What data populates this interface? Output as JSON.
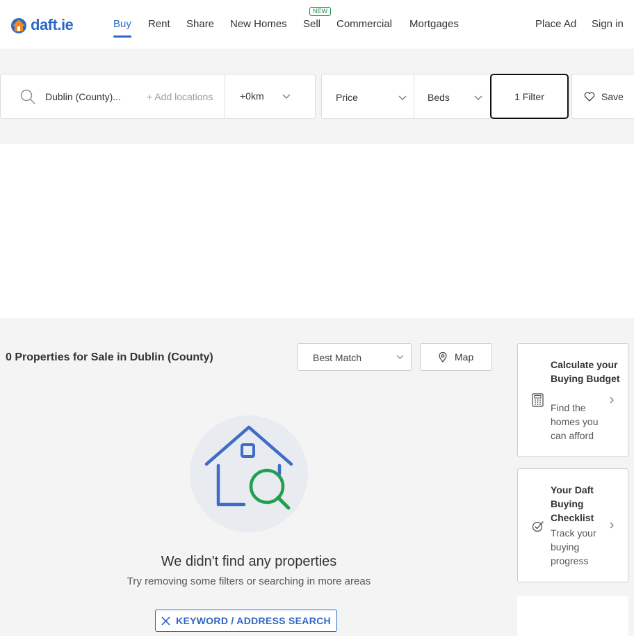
{
  "header": {
    "logo_text": "daft.ie",
    "nav": [
      {
        "label": "Buy"
      },
      {
        "label": "Rent"
      },
      {
        "label": "Share"
      },
      {
        "label": "New Homes"
      },
      {
        "label": "Sell"
      },
      {
        "label": "Commercial"
      },
      {
        "label": "Mortgages"
      }
    ],
    "new_badge": "NEW",
    "place_ad": "Place Ad",
    "sign_in": "Sign in",
    "accent_color": "#2d68c4"
  },
  "search": {
    "location": "Dublin (County)...",
    "add_locations": "+ Add locations",
    "radius": "+0km",
    "price": "Price",
    "beds": "Beds",
    "filter": "1 Filter",
    "save": "Save"
  },
  "results": {
    "title": "0 Properties for Sale in Dublin (County)",
    "sort": "Best Match",
    "map": "Map"
  },
  "empty": {
    "title": "We didn't find any properties",
    "subtitle": "Try removing some filters or searching in more areas",
    "keyword_button": "KEYWORD / ADDRESS SEARCH"
  },
  "sidebar": {
    "cards": [
      {
        "title": "Calculate your Buying Budget",
        "desc": "Find the homes you can afford",
        "icon": "calculator-icon"
      },
      {
        "title": "Your Daft Buying Checklist",
        "desc": "Track your buying progress",
        "icon": "checklist-icon"
      }
    ]
  }
}
